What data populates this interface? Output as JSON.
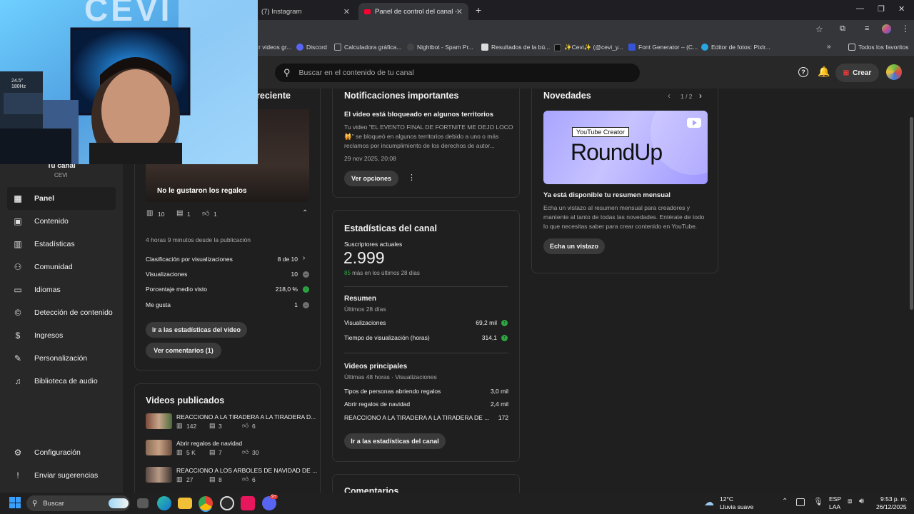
{
  "browser": {
    "tabs": [
      {
        "label": "(7) Instagram",
        "active": false
      },
      {
        "label": "Panel de control del canal - You",
        "active": true
      }
    ],
    "bookmarks": [
      "r videos gr...",
      "Discord",
      "Calculadora gráfica...",
      "Nightbot - Spam Pr...",
      "Resultados de la bú...",
      "✨Cevi✨ (@cevi_y...",
      "Font Generator – (C...",
      "Editor de fotos: Pixlr..."
    ],
    "all_favorites": "Todos los favoritos"
  },
  "header": {
    "search_placeholder": "Buscar en el contenido de tu canal",
    "create_label": "Crear"
  },
  "sidebar": {
    "channel_label": "Tu canal",
    "channel_name": "CEVI",
    "items": [
      {
        "label": "Panel",
        "icon": "dashboard-icon",
        "active": true
      },
      {
        "label": "Contenido",
        "icon": "content-icon"
      },
      {
        "label": "Estadísticas",
        "icon": "analytics-icon"
      },
      {
        "label": "Comunidad",
        "icon": "community-icon"
      },
      {
        "label": "Idiomas",
        "icon": "subtitles-icon"
      },
      {
        "label": "Detección de contenido",
        "icon": "copyright-icon"
      },
      {
        "label": "Ingresos",
        "icon": "earn-icon"
      },
      {
        "label": "Personalización",
        "icon": "customization-icon"
      },
      {
        "label": "Biblioteca de audio",
        "icon": "audio-library-icon"
      }
    ],
    "settings_label": "Configuración",
    "feedback_label": "Enviar sugerencias"
  },
  "latest_video": {
    "heading_partial": "reciente",
    "thumb_title": "No le gustaron los regalos",
    "views_count": "10",
    "comments_count": "1",
    "likes_count": "1",
    "time_since": "4 horas 9 minutos desde la publicación",
    "stats": [
      {
        "label": "Clasificación por visualizaciones",
        "value": "8 de 10"
      },
      {
        "label": "Visualizaciones",
        "value": "10"
      },
      {
        "label": "Porcentaje medio visto",
        "value": "218,0 %"
      },
      {
        "label": "Me gusta",
        "value": "1"
      }
    ],
    "btn_stats": "Ir a las estadísticas del video",
    "btn_comments": "Ver comentarios (1)"
  },
  "published": {
    "heading": "Videos publicados",
    "items": [
      {
        "title": "REACCIONO A LA TIRADERA A LA TIRADERA D...",
        "views": "142",
        "comments": "3",
        "likes": "6"
      },
      {
        "title": "Abrir regalos de navidad",
        "views": "5 K",
        "comments": "7",
        "likes": "30"
      },
      {
        "title": "REACCIONO A LOS ARBOLES DE NAVIDAD DE ...",
        "views": "27",
        "comments": "8",
        "likes": "6"
      }
    ]
  },
  "notifications": {
    "heading": "Notificaciones importantes",
    "title": "El video está bloqueado en algunos territorios",
    "body_line1": "Tu video \"EL EVENTO FINAL DE FORTNITE ME DEJO LOCO",
    "body_line2": "🙀\" se bloqueó en algunos territorios debido a uno o más",
    "body_line3": "reclamos por incumplimiento de los derechos de autor...",
    "date": "29 nov 2025, 20:08",
    "btn": "Ver opciones"
  },
  "channel_stats": {
    "heading": "Estadísticas del canal",
    "subs_label": "Suscriptores actuales",
    "subs_value": "2.999",
    "subs_delta": "85",
    "subs_delta_text": "más en los últimos 28 días",
    "summary_heading": "Resumen",
    "summary_period": "Últimos 28 días",
    "summary": [
      {
        "label": "Visualizaciones",
        "value": "69,2 mil"
      },
      {
        "label": "Tiempo de visualización (horas)",
        "value": "314,1"
      }
    ],
    "top_heading": "Videos principales",
    "top_period": "Últimas 48 horas · Visualizaciones",
    "top": [
      {
        "label": "Tipos de personas abriendo regalos",
        "value": "3,0 mil"
      },
      {
        "label": "Abrir regalos de navidad",
        "value": "2,4 mil"
      },
      {
        "label": "REACCIONO A LA TIRADERA A LA TIRADERA DE ...",
        "value": "172"
      }
    ],
    "btn": "Ir a las estadísticas del canal"
  },
  "comments_heading": "Comentarios",
  "news": {
    "heading": "Novedades",
    "pager": "1 / 2",
    "banner_tag": "YouTube Creator",
    "banner_title": "RoundUp",
    "title": "Ya está disponible tu resumen mensual",
    "body_line1": "Echa un vistazo al resumen mensual para creadores y",
    "body_line2": "mantente al tanto de todas las novedades. Entérate de todo",
    "body_line3": "lo que necesitas saber para crear contenido en YouTube.",
    "btn": "Echa un vistazo"
  },
  "webcam_overlay": {
    "logo_text": "CEVI",
    "monitor_text": "24.5\" 180Hz"
  },
  "taskbar": {
    "search_label": "Buscar",
    "weather_temp": "12°C",
    "weather_desc": "Lluvia suave",
    "lang_top": "ESP",
    "lang_bottom": "LAA",
    "time": "9:53 p. m.",
    "date": "26/12/2025",
    "discord_badge": "9+"
  },
  "colors": {
    "accent_red": "#ff0033",
    "positive_green": "#2ba640",
    "card_bg": "#1f1f1f",
    "header_bg": "#282828"
  }
}
